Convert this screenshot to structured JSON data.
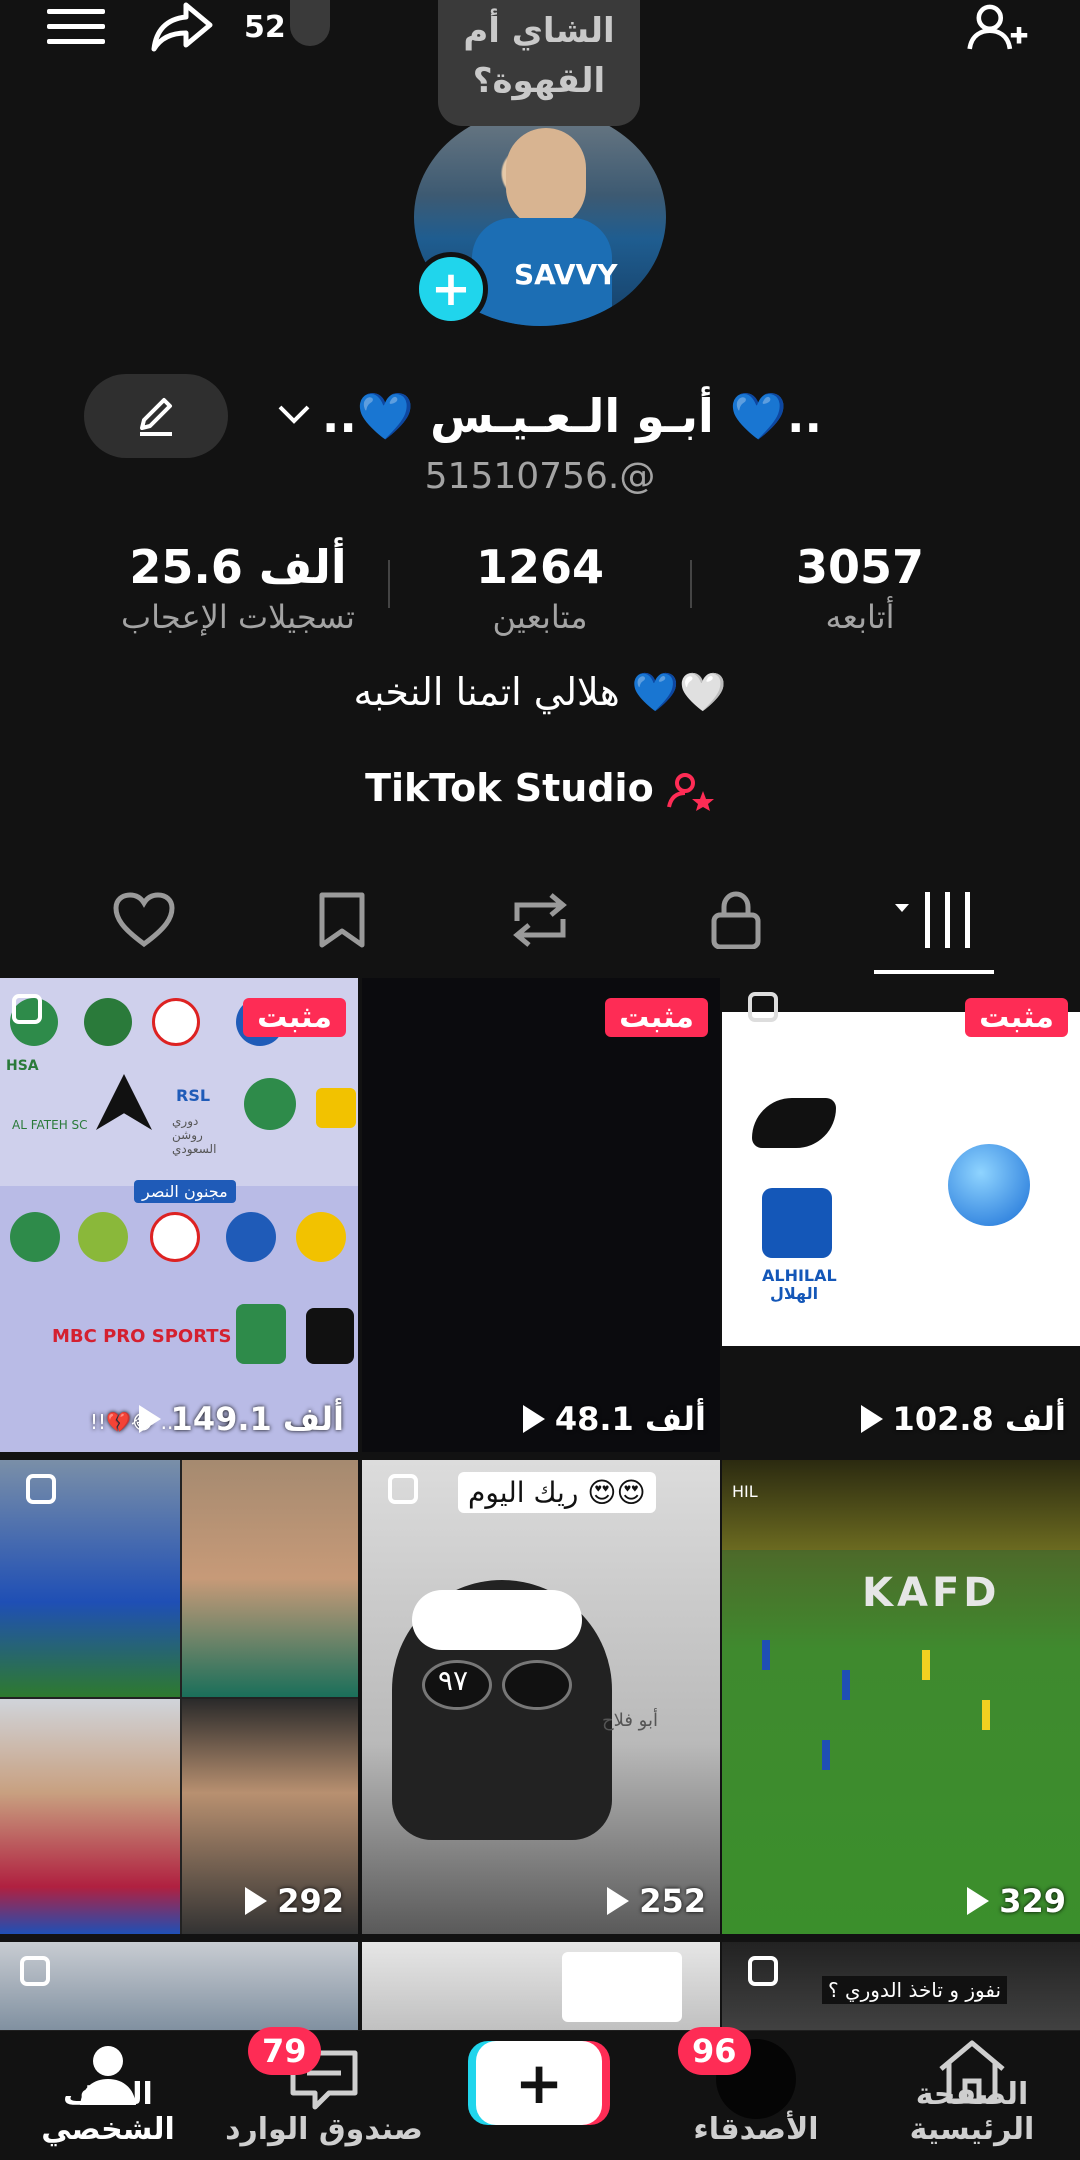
{
  "top": {
    "notif_count": "52",
    "tooltip": "الشاي أم القهوة؟"
  },
  "profile": {
    "name": "..💙 أبـو الـعـيـس 💙..",
    "username": "51510756.@",
    "stats": [
      {
        "value": "3057",
        "label": "أتابعه"
      },
      {
        "value": "1264",
        "label": "متابعين"
      },
      {
        "value": "25.6 ألف",
        "label": "تسجيلات الإعجاب"
      }
    ],
    "bio": "هلالي اتمنا النخبه 💙🤍",
    "studio": "TikTok Studio"
  },
  "grid": {
    "pinned_label": "مثبت",
    "cells": [
      {
        "views": "102.8 ألف",
        "pinned": true
      },
      {
        "views": "48.1 ألف",
        "pinned": true
      },
      {
        "views": "149.1 ألف",
        "pinned": true,
        "overlay": "!!💔😂 ..."
      },
      {
        "views": "329",
        "overlay": "KAFD"
      },
      {
        "views": "252",
        "overlay": "ريك اليوم 😍😍"
      },
      {
        "views": "292"
      },
      {
        "overlay": "نفوز و تاخذ الدوري ؟"
      },
      {},
      {}
    ],
    "cell_texts": {
      "alhilal_en": "ALHILAL",
      "alhilal_ar": "الهلال",
      "mbc": "MBC PRO SPORTS",
      "majnoon": "مجنون النصر",
      "num97": "٩٧",
      "rsl": "RSL",
      "hilal_small": "HIL",
      "alfateh": "AL FATEH SC",
      "hsa": "HSA",
      "rsl_ar": "دوري روشن السعودي",
      "aboflah": "أبو فلاح",
      "jersey": "SAVVY"
    }
  },
  "nav": {
    "home": "الصفحة الرئيسية",
    "friends": "الأصدقاء",
    "friends_badge": "96",
    "inbox": "صندوق الوارد",
    "inbox_badge": "79",
    "profile": "الملف الشخصي"
  }
}
